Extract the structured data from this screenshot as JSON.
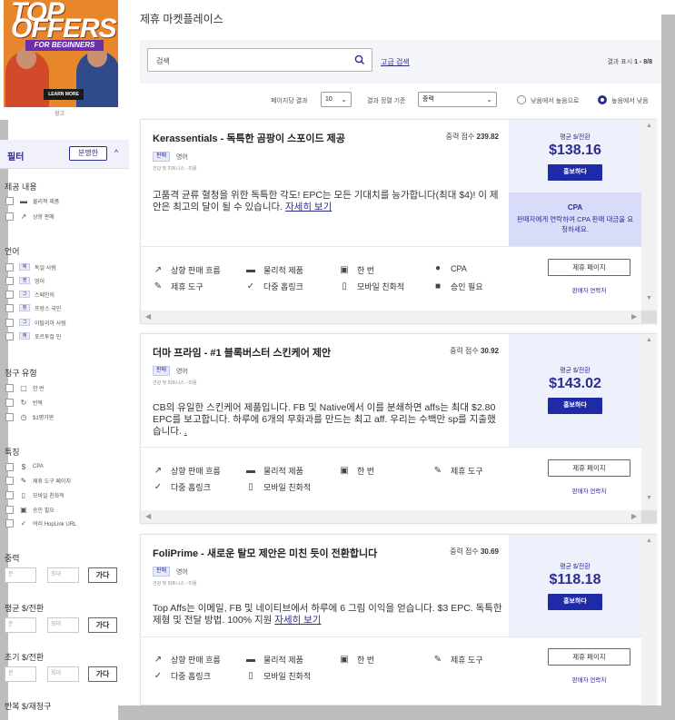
{
  "ad": {
    "headline_1": "TOP",
    "headline_2": "OFFERS",
    "banner": "FOR BEGINNERS",
    "learn_more": "LEARN MORE",
    "caption": "광고"
  },
  "filter": {
    "title": "필터",
    "clear_label": "분명한",
    "sections": {
      "offer_content": {
        "title": "제공 내용",
        "items": [
          "물리적 제품",
          "상향 판매"
        ]
      },
      "language": {
        "title": "언어",
        "items": [
          {
            "flag": "에",
            "label": "독일 사람"
          },
          {
            "flag": "엔",
            "label": "영어"
          },
          {
            "flag": "그",
            "label": "스페인의"
          },
          {
            "flag": "정",
            "label": "프랑스 국민"
          },
          {
            "flag": "그",
            "label": "이탈리아 사람"
          },
          {
            "flag": "에",
            "label": "포르투칼 인"
          }
        ]
      },
      "billing": {
        "title": "청구 유형",
        "items": [
          "한 번",
          "반복",
          "$1평가판"
        ]
      },
      "features": {
        "title": "특징",
        "items": [
          "CPA",
          "제휴 도구 페이지",
          "모바일 친화적",
          "승인 필요",
          "여러 HopLink URL"
        ]
      }
    },
    "ranges": [
      {
        "title": "중력",
        "min_ph": "분",
        "max_ph": "최대",
        "go": "가다"
      },
      {
        "title": "평균 $/전환",
        "min_ph": "분",
        "max_ph": "최대",
        "go": "가다"
      },
      {
        "title": "초기 $/전환",
        "min_ph": "분",
        "max_ph": "최대",
        "go": "가다"
      },
      {
        "title": "반복 $/재청구"
      }
    ]
  },
  "main": {
    "title": "제휴 마켓플레이스",
    "search_placeholder": "검색",
    "advanced_search": "고급 검색",
    "results_prefix": "결과 표시",
    "results_range": "1 - 8/8",
    "per_page_label": "페이지당 결과",
    "per_page_value": "10",
    "sort_label": "결과 정렬 기준",
    "sort_value": "중력",
    "sort_asc": "낮음에서 높음으로",
    "sort_desc": "높음에서 낮음"
  },
  "cards": [
    {
      "title": "Kerassentials - 독특한 곰팡이 스포이드 제공",
      "score_label": "중력 점수",
      "score": "239.82",
      "tag": "판매",
      "lang": "영어",
      "category": "건강 및 피트니스 - 미용",
      "desc": "고품격 균류 혈청을 위한 독특한 각도! EPC는 모든 기대치를 능가합니다(최대 $4)! 이 제안은 최고의 달이 될 수 있습니다.",
      "more": "자세히 보기",
      "price_label": "평균 $/전환",
      "price": "$138.16",
      "promote": "홍보하다",
      "cpa_title": "CPA",
      "cpa_text": "판매자에게 연락하여 CPA 판매 대금을 요청하세요.",
      "attrs": [
        "상향 판매 흐름",
        "물리적 제품",
        "한 번",
        "CPA",
        "제휴 도구",
        "다중 홉링크",
        "모바일 친화적",
        "승인 필요"
      ],
      "btn": "제휴 페이지",
      "link": "판매자 연락처"
    },
    {
      "title": "더마 프라임 - #1 블록버스터 스킨케어 제안",
      "score_label": "중력 점수",
      "score": "30.92",
      "tag": "판매",
      "lang": "영어",
      "category": "건강 및 피트니스 - 미용",
      "desc": "CB의 유일한 스킨케어 제품입니다. FB 및 Native에서 이를 분쇄하면 affs는 최대 $2.80 EPC를 보고합니다. 하루에 6개의 무화과를 만드는 최고 aff. 우리는 수백만 sp를 지출했습니다.",
      "more": ".",
      "price_label": "평균 $/전환",
      "price": "$143.02",
      "promote": "홍보하다",
      "attrs": [
        "상향 판매 흐름",
        "물리적 제품",
        "한 번",
        "제휴 도구",
        "다중 홉링크",
        "모바일 친화적"
      ],
      "btn": "제휴 페이지",
      "link": "판매자 연락처"
    },
    {
      "title": "FoliPrime - 새로운 탈모 제안은 미친 듯이 전환합니다",
      "score_label": "중력 점수",
      "score": "30.69",
      "tag": "판매",
      "lang": "영어",
      "category": "건강 및 피트니스 - 미용",
      "desc": "Top Affs는 이메일, FB 및 네이티브에서 하루에 6 그림 이익을 얻습니다. $3 EPC. 독특한 제형 및 전달 방법. 100% 지원",
      "more": "자세히 보기",
      "price_label": "평균 $/전환",
      "price": "$118.18",
      "promote": "홍보하다",
      "attrs": [
        "상향 판매 흐름",
        "물리적 제품",
        "한 번",
        "제휴 도구",
        "다중 홉링크",
        "모바일 친화적"
      ],
      "btn": "제휴 페이지",
      "link": "판매자 연락처"
    }
  ]
}
